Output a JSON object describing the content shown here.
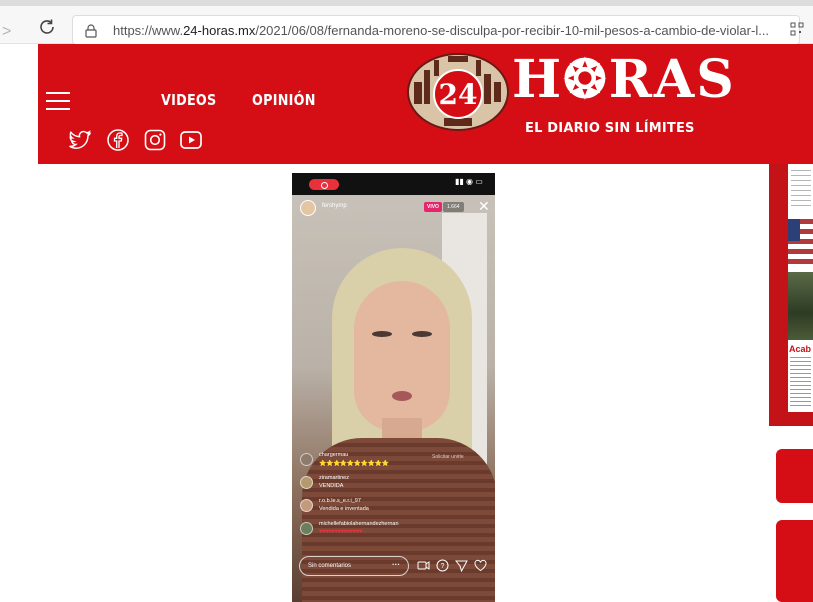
{
  "browser": {
    "url_prefix": "https://www.",
    "url_domain": "24-horas.mx",
    "url_path": "/2021/06/08/fernanda-moreno-se-disculpa-por-recibir-10-mil-pesos-a-cambio-de-violar-l...",
    "icons": [
      "forward-arrow-icon",
      "reload-icon",
      "lock-icon",
      "qr-code-icon"
    ]
  },
  "header": {
    "nav": [
      {
        "label": "VIDEOS"
      },
      {
        "label": "OPINIÓN"
      }
    ],
    "logo_number": "24",
    "logo_word": "H❂RAS",
    "tagline": "EL DIARIO SIN LÍMITES",
    "social_icons": [
      "twitter-icon",
      "facebook-icon",
      "instagram-icon",
      "youtube-icon"
    ],
    "brand_color": "#d40e14"
  },
  "video": {
    "username": "fershymp",
    "live_label": "VIVO",
    "viewers": "1.664",
    "invite_text": "Solicitar unirte",
    "comments": [
      {
        "user": "chargermau",
        "text": "⭐⭐⭐⭐⭐⭐⭐⭐⭐⭐",
        "kind": "stars"
      },
      {
        "user": "ziramartinez",
        "text": "VENDIDA",
        "kind": "text"
      },
      {
        "user": "r.o.b.le.s_e.r.i_97",
        "text": "Vendida e inventada",
        "kind": "text"
      },
      {
        "user": "michellefabiolahernandezhernan",
        "text": "♥♥♥♥♥♥♥♥♥♥♥♥♥♥",
        "kind": "hearts"
      }
    ],
    "comment_placeholder": "Sin comentarios",
    "more_label": "···"
  },
  "sidebar": {
    "paper_headline": "Acab"
  }
}
